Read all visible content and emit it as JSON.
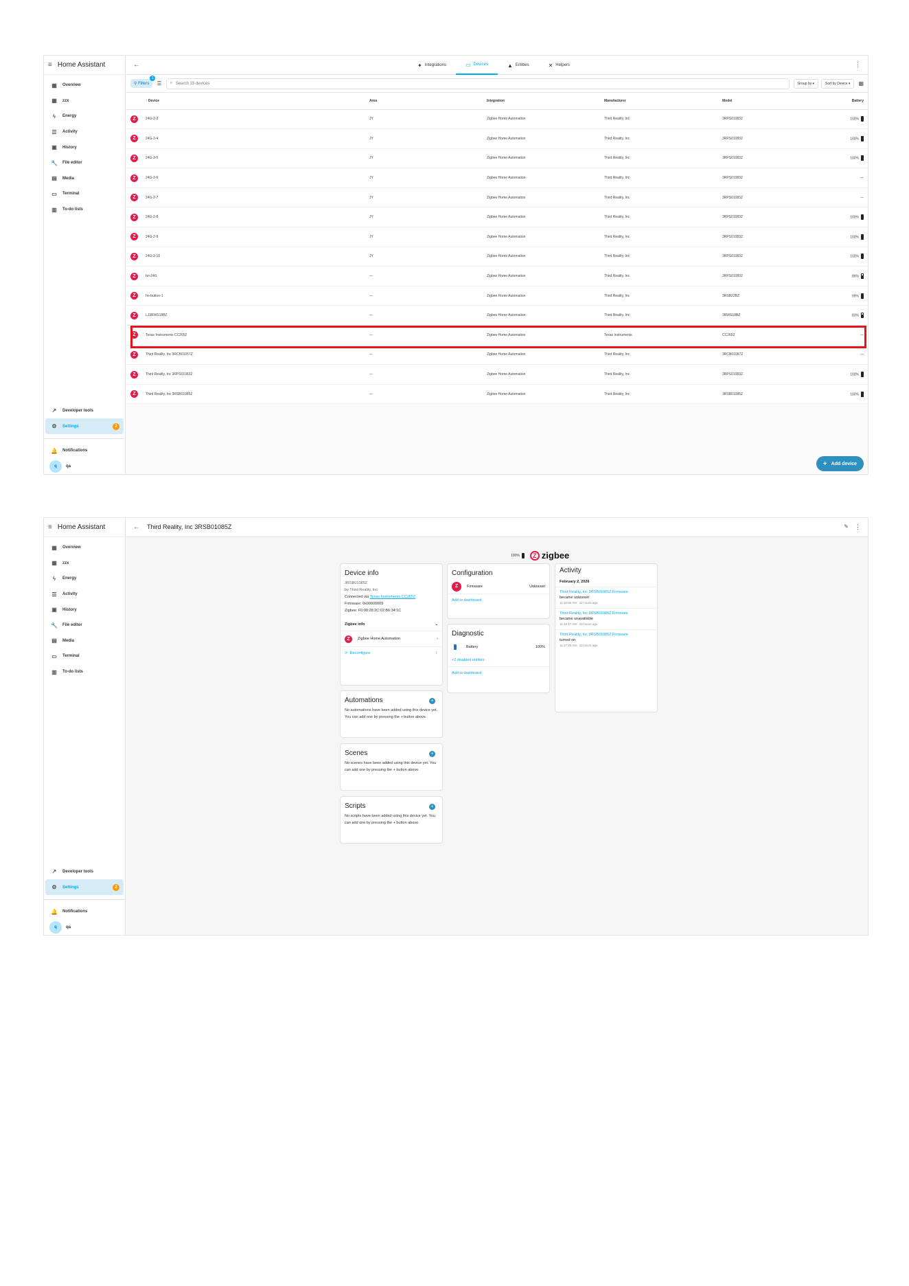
{
  "app": {
    "title": "Home Assistant"
  },
  "sidebar": {
    "items": [
      {
        "label": "Overview",
        "icon": "dashboard-icon"
      },
      {
        "label": "zzx",
        "icon": "dashboard-icon"
      },
      {
        "label": "Energy",
        "icon": "lightning-icon"
      },
      {
        "label": "Activity",
        "icon": "list-icon"
      },
      {
        "label": "History",
        "icon": "chart-box-icon"
      },
      {
        "label": "File editor",
        "icon": "wrench-icon"
      },
      {
        "label": "Media",
        "icon": "media-icon"
      },
      {
        "label": "Terminal",
        "icon": "console-icon"
      },
      {
        "label": "To-do lists",
        "icon": "clipboard-list-icon"
      }
    ],
    "developer_tools": "Developer tools",
    "settings": "Settings",
    "settings_badge": "2",
    "notifications": "Notifications",
    "user_initial": "q",
    "user_name": "qa"
  },
  "devices_page": {
    "tabs": [
      "Integrations",
      "Devices",
      "Entities",
      "Helpers"
    ],
    "active_tab": "Devices",
    "filters_label": "Filters",
    "filters_badge": "1",
    "search_placeholder": "Search 15 devices",
    "group_by": "Group by",
    "sort_by": "Sort by Device",
    "columns": [
      "Device",
      "Area",
      "Integration",
      "Manufacturer",
      "Model",
      "Battery"
    ],
    "rows": [
      {
        "device": "24G-2-3",
        "area": "JY",
        "integration": "Zigbee Home Automation",
        "manufacturer": "Third Reality, Inc",
        "model": "3RPS01083Z",
        "battery": "100%"
      },
      {
        "device": "24G-2-4",
        "area": "JY",
        "integration": "Zigbee Home Automation",
        "manufacturer": "Third Reality, Inc",
        "model": "3RPS01083Z",
        "battery": "100%"
      },
      {
        "device": "24G-2-5",
        "area": "JY",
        "integration": "Zigbee Home Automation",
        "manufacturer": "Third Reality, Inc",
        "model": "3RPS01083Z",
        "battery": "100%"
      },
      {
        "device": "24G-2-6",
        "area": "JY",
        "integration": "Zigbee Home Automation",
        "manufacturer": "Third Reality, Inc",
        "model": "3RPS01083Z",
        "battery": "—"
      },
      {
        "device": "24G-2-7",
        "area": "JY",
        "integration": "Zigbee Home Automation",
        "manufacturer": "Third Reality, Inc",
        "model": "3RPS01083Z",
        "battery": "—"
      },
      {
        "device": "24G-2-8",
        "area": "JY",
        "integration": "Zigbee Home Automation",
        "manufacturer": "Third Reality, Inc",
        "model": "3RPS01083Z",
        "battery": "100%"
      },
      {
        "device": "24G-2-9",
        "area": "JY",
        "integration": "Zigbee Home Automation",
        "manufacturer": "Third Reality, Inc",
        "model": "3RPS01083Z",
        "battery": "100%"
      },
      {
        "device": "24G-2-10",
        "area": "JY",
        "integration": "Zigbee Home Automation",
        "manufacturer": "Third Reality, Inc",
        "model": "3RPS01083Z",
        "battery": "100%"
      },
      {
        "device": "hn-24G",
        "area": "—",
        "integration": "Zigbee Home Automation",
        "manufacturer": "Third Reality, Inc",
        "model": "3RPS01083Z",
        "battery": "86%"
      },
      {
        "device": "hn-button-1",
        "area": "—",
        "integration": "Zigbee Home Automation",
        "manufacturer": "Third Reality, Inc",
        "model": "3RSB22BZ",
        "battery": "99%"
      },
      {
        "device": "LJ3RWS18BZ",
        "area": "—",
        "integration": "Zigbee Home Automation",
        "manufacturer": "Third Reality, Inc",
        "model": "3RWS18BZ",
        "battery": "83%"
      },
      {
        "device": "Texas Instruments CC2652",
        "area": "—",
        "integration": "Zigbee Home Automation",
        "manufacturer": "Texas Instruments",
        "model": "CC2652",
        "battery": "—"
      },
      {
        "device": "Third Reality, Inc 3RCB01057Z",
        "area": "—",
        "integration": "Zigbee Home Automation",
        "manufacturer": "Third Reality, Inc",
        "model": "3RCB01057Z",
        "battery": "—"
      },
      {
        "device": "Third Reality, Inc 3RPS01083Z",
        "area": "—",
        "integration": "Zigbee Home Automation",
        "manufacturer": "Third Reality, Inc",
        "model": "3RPS01083Z",
        "battery": "100%"
      },
      {
        "device": "Third Reality, Inc 3RSB01085Z",
        "area": "—",
        "integration": "Zigbee Home Automation",
        "manufacturer": "Third Reality, Inc",
        "model": "3RSB01085Z",
        "battery": "100%"
      }
    ],
    "add_device": "Add device",
    "highlight_color": "#e4141b"
  },
  "device_page": {
    "title": "Third Reality, Inc 3RSB01085Z",
    "battery_pct": "100%",
    "zigbee_logo": "zigbee",
    "device_info": {
      "title": "Device info",
      "model": "3RSB01085Z",
      "by": "by Third Reality, Inc",
      "connected_prefix": "Connected via ",
      "connected_link": "Texas Instruments CC2652",
      "firmware": "Firmware: 0x00000009",
      "zigbee": "Zigbee: F0:00:28:2C:02:B6:34:1C",
      "zigbee_info": "Zigbee info",
      "integration": "Zigbee Home Automation",
      "reconfigure": "Reconfigure"
    },
    "automations": {
      "title": "Automations",
      "text": "No automations have been added using this device yet. You can add one by pressing the + button above."
    },
    "scenes": {
      "title": "Scenes",
      "text": "No scenes have been added using this device yet. You can add one by pressing the + button above."
    },
    "scripts": {
      "title": "Scripts",
      "text": "No scripts have been added using this device yet. You can add one by pressing the + button above."
    },
    "configuration": {
      "title": "Configuration",
      "firmware_label": "Firmware",
      "firmware_value": "Unknown",
      "add_to_dashboard": "Add to dashboard"
    },
    "diagnostic": {
      "title": "Diagnostic",
      "battery_label": "Battery",
      "battery_value": "100%",
      "disabled_entities": "+2 disabled entities",
      "add_to_dashboard": "Add to dashboard"
    },
    "activity": {
      "title": "Activity",
      "date": "February 2, 2026",
      "items": [
        {
          "entity": "Third Reality, Inc 3RSB01085Z Firmware",
          "event": "became unknown",
          "time": "11:18:56 AM · 22 hours ago"
        },
        {
          "entity": "Third Reality, Inc 3RSB01085Z Firmware",
          "event": "became unavailable",
          "time": "11:18:47 AM · 22 hours ago"
        },
        {
          "entity": "Third Reality, Inc 3RSB01085Z Firmware",
          "event": "turned on",
          "time": "11:17:26 AM · 22 hours ago"
        }
      ]
    }
  }
}
